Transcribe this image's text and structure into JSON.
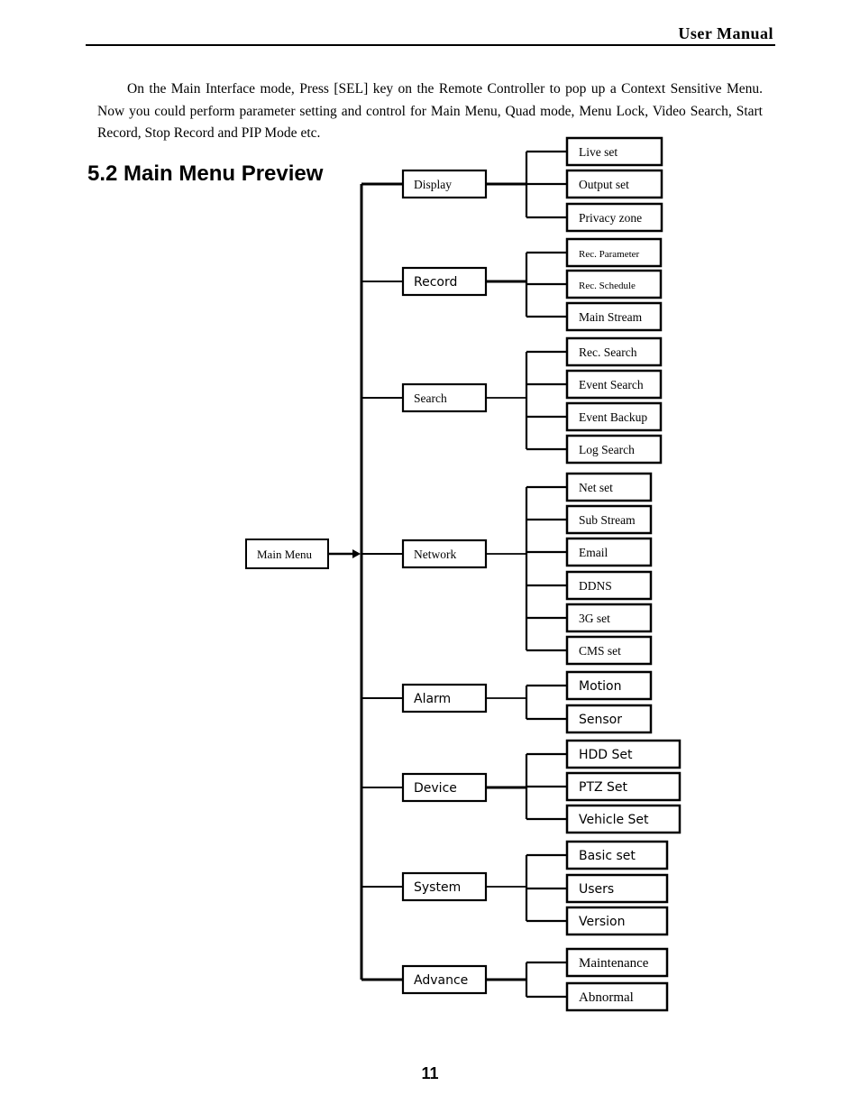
{
  "header": {
    "title": "User  Manual"
  },
  "intro_paragraph": "On the Main Interface mode, Press [SEL] key on the Remote Controller to pop up a Context Sensitive Menu. Now you could perform parameter setting and control for Main Menu, Quad mode, Menu Lock, Video Search, Start Record, Stop Record and PIP Mode etc.",
  "section_title": "5.2 Main Menu Preview",
  "diagram": {
    "root": "Main Menu",
    "menus": [
      {
        "label": "Display",
        "children": [
          "Live set",
          "Output set",
          "Privacy zone"
        ]
      },
      {
        "label": "Record",
        "children": [
          "Rec. Parameter",
          "Rec. Schedule",
          "Main Stream"
        ]
      },
      {
        "label": "Search",
        "children": [
          "Rec. Search",
          "Event Search",
          "Event Backup",
          "Log Search"
        ]
      },
      {
        "label": "Network",
        "children": [
          "Net set",
          "Sub Stream",
          "Email",
          "DDNS",
          "3G set",
          "CMS set"
        ]
      },
      {
        "label": "Alarm",
        "children": [
          "Motion",
          "Sensor"
        ]
      },
      {
        "label": "Device",
        "children": [
          "HDD Set",
          "PTZ Set",
          "Vehicle Set"
        ]
      },
      {
        "label": "System",
        "children": [
          "Basic set",
          "Users",
          "Version"
        ]
      },
      {
        "label": "Advance",
        "children": [
          "Maintenance",
          "Abnormal"
        ]
      }
    ]
  },
  "footer": {
    "page_number": "11"
  }
}
